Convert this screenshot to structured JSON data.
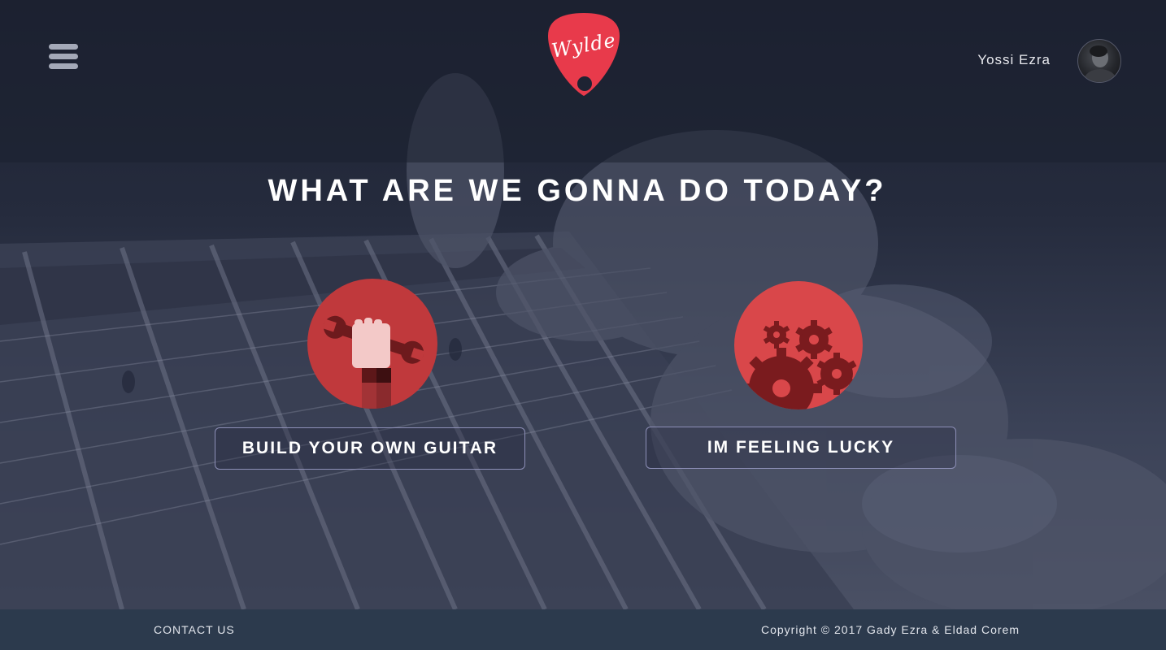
{
  "header": {
    "menu_icon": "hamburger-menu-icon",
    "logo_text": "Wylde",
    "user_name": "Yossi Ezra"
  },
  "main": {
    "headline": "WHAT ARE WE GONNA DO TODAY?",
    "options": [
      {
        "label": "BUILD YOUR OWN GUITAR",
        "icon": "wrench-hand-icon"
      },
      {
        "label": "IM FEELING LUCKY",
        "icon": "gears-icon"
      }
    ]
  },
  "footer": {
    "contact_label": "CONTACT US",
    "copyright": "Copyright © 2017 Gady Ezra & Eldad Corem"
  },
  "colors": {
    "brand_red": "#e83a4b",
    "circle_red": "#c0393c",
    "footer_bg": "#2c3a4d",
    "button_border": "#8d8fb7"
  }
}
